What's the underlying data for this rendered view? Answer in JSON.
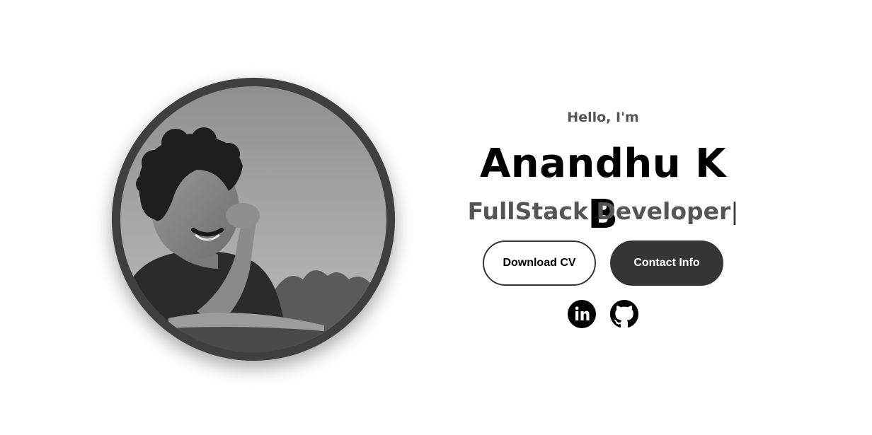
{
  "profile": {
    "greeting": "Hello, I'm",
    "name": "Anandhu K B",
    "title": "FullStack Developer",
    "cursor": "|",
    "photo_alt": "Profile picture"
  },
  "actions": {
    "download_cv_label": "Download CV",
    "contact_info_label": "Contact Info"
  },
  "socials": [
    {
      "icon": "linkedin-icon",
      "label": "My LinkedIn profile"
    },
    {
      "icon": "github-icon",
      "label": "My Git profile"
    }
  ],
  "colors": {
    "button_dark": "#353535",
    "text_muted": "#555555",
    "heading": "#000000",
    "background": "#ffffff"
  }
}
